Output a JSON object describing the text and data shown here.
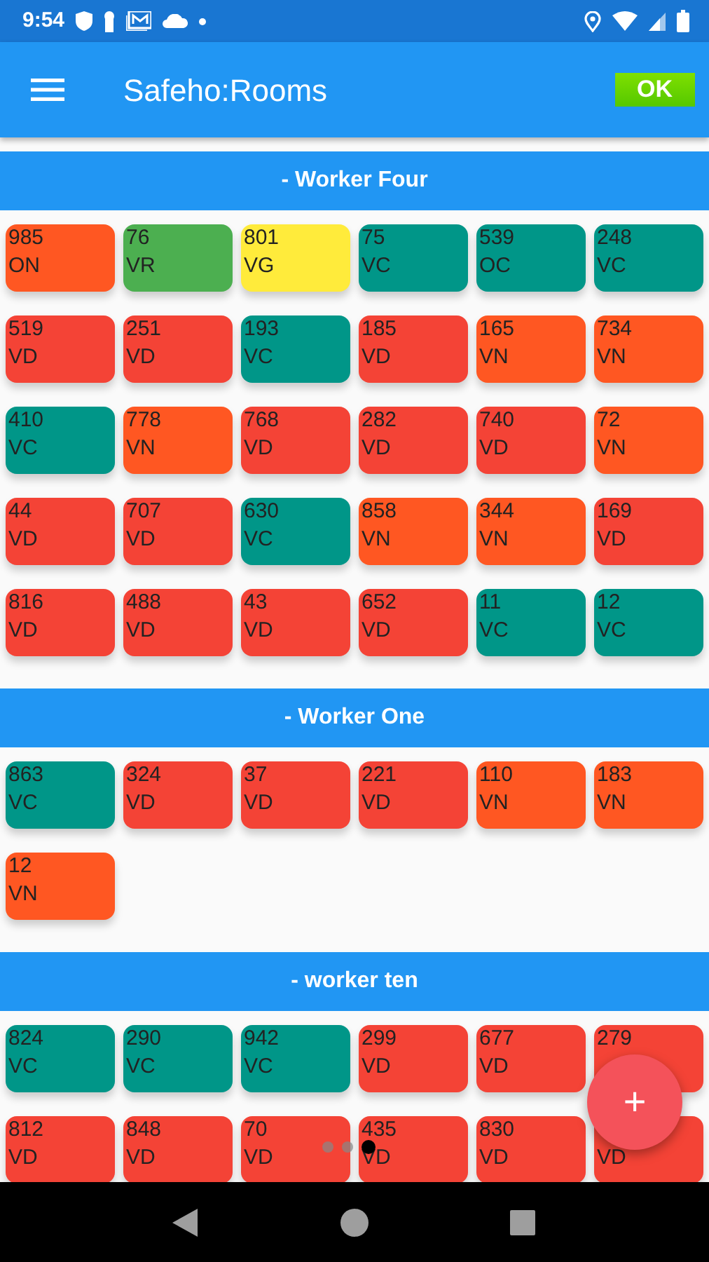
{
  "status_bar": {
    "time": "9:54"
  },
  "app_bar": {
    "title": "Safeho:Rooms",
    "ok_button": "OK"
  },
  "sections": [
    {
      "title": "- Worker Four",
      "rooms": [
        {
          "number": "985",
          "status": "ON",
          "color": "#ff5722"
        },
        {
          "number": "76",
          "status": "VR",
          "color": "#4caf50"
        },
        {
          "number": "801",
          "status": "VG",
          "color": "#ffeb3b"
        },
        {
          "number": "75",
          "status": "VC",
          "color": "#009688"
        },
        {
          "number": "539",
          "status": "OC",
          "color": "#009688"
        },
        {
          "number": "248",
          "status": "VC",
          "color": "#009688"
        },
        {
          "number": "519",
          "status": "VD",
          "color": "#f44336"
        },
        {
          "number": "251",
          "status": "VD",
          "color": "#f44336"
        },
        {
          "number": "193",
          "status": "VC",
          "color": "#009688"
        },
        {
          "number": "185",
          "status": "VD",
          "color": "#f44336"
        },
        {
          "number": "165",
          "status": "VN",
          "color": "#ff5722"
        },
        {
          "number": "734",
          "status": "VN",
          "color": "#ff5722"
        },
        {
          "number": "410",
          "status": "VC",
          "color": "#009688"
        },
        {
          "number": "778",
          "status": "VN",
          "color": "#ff5722"
        },
        {
          "number": "768",
          "status": "VD",
          "color": "#f44336"
        },
        {
          "number": "282",
          "status": "VD",
          "color": "#f44336"
        },
        {
          "number": "740",
          "status": "VD",
          "color": "#f44336"
        },
        {
          "number": "72",
          "status": "VN",
          "color": "#ff5722"
        },
        {
          "number": "44",
          "status": "VD",
          "color": "#f44336"
        },
        {
          "number": "707",
          "status": "VD",
          "color": "#f44336"
        },
        {
          "number": "630",
          "status": "VC",
          "color": "#009688"
        },
        {
          "number": "858",
          "status": "VN",
          "color": "#ff5722"
        },
        {
          "number": "344",
          "status": "VN",
          "color": "#ff5722"
        },
        {
          "number": "169",
          "status": "VD",
          "color": "#f44336"
        },
        {
          "number": "816",
          "status": "VD",
          "color": "#f44336"
        },
        {
          "number": "488",
          "status": "VD",
          "color": "#f44336"
        },
        {
          "number": "43",
          "status": "VD",
          "color": "#f44336"
        },
        {
          "number": "652",
          "status": "VD",
          "color": "#f44336"
        },
        {
          "number": "11",
          "status": "VC",
          "color": "#009688"
        },
        {
          "number": "12",
          "status": "VC",
          "color": "#009688"
        }
      ]
    },
    {
      "title": "- Worker One",
      "rooms": [
        {
          "number": "863",
          "status": "VC",
          "color": "#009688"
        },
        {
          "number": "324",
          "status": "VD",
          "color": "#f44336"
        },
        {
          "number": "37",
          "status": "VD",
          "color": "#f44336"
        },
        {
          "number": "221",
          "status": "VD",
          "color": "#f44336"
        },
        {
          "number": "110",
          "status": "VN",
          "color": "#ff5722"
        },
        {
          "number": "183",
          "status": "VN",
          "color": "#ff5722"
        },
        {
          "number": "12",
          "status": "VN",
          "color": "#ff5722"
        }
      ]
    },
    {
      "title": "- worker ten",
      "rooms": [
        {
          "number": "824",
          "status": "VC",
          "color": "#009688"
        },
        {
          "number": "290",
          "status": "VC",
          "color": "#009688"
        },
        {
          "number": "942",
          "status": "VC",
          "color": "#009688"
        },
        {
          "number": "299",
          "status": "VD",
          "color": "#f44336"
        },
        {
          "number": "677",
          "status": "VD",
          "color": "#f44336"
        },
        {
          "number": "279",
          "color": "#f44336"
        },
        {
          "number": "812",
          "status": "VD",
          "color": "#f44336"
        },
        {
          "number": "848",
          "status": "VD",
          "color": "#f44336"
        },
        {
          "number": "70",
          "status": "VD",
          "color": "#f44336"
        },
        {
          "number": "435",
          "status": "VD",
          "color": "#f44336"
        },
        {
          "number": "830",
          "status": "VD",
          "color": "#f44336"
        },
        {
          "status": "VD",
          "color": "#f44336"
        }
      ]
    }
  ],
  "page_indicator": [
    {
      "selected": false
    },
    {
      "selected": false
    },
    {
      "selected": true
    }
  ],
  "fab": "+"
}
